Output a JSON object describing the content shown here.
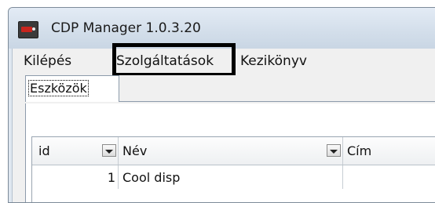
{
  "window": {
    "title": "CDP Manager 1.0.3.20",
    "icon": "app-icon"
  },
  "menubar": {
    "items": [
      {
        "label": "Kilépés"
      },
      {
        "label": "Szolgáltatások",
        "highlighted": true
      },
      {
        "label": "Kezikönyv"
      }
    ]
  },
  "tabs": {
    "active": "Eszközök"
  },
  "grid": {
    "columns": [
      "id",
      "Név",
      "Cím"
    ],
    "rows": [
      {
        "id": "1",
        "name": "Cool disp",
        "address": ""
      }
    ]
  },
  "colors": {
    "highlight_border": "#000000",
    "title_bar": "#d4dfeb",
    "menu_background": "#f0f0f0"
  }
}
